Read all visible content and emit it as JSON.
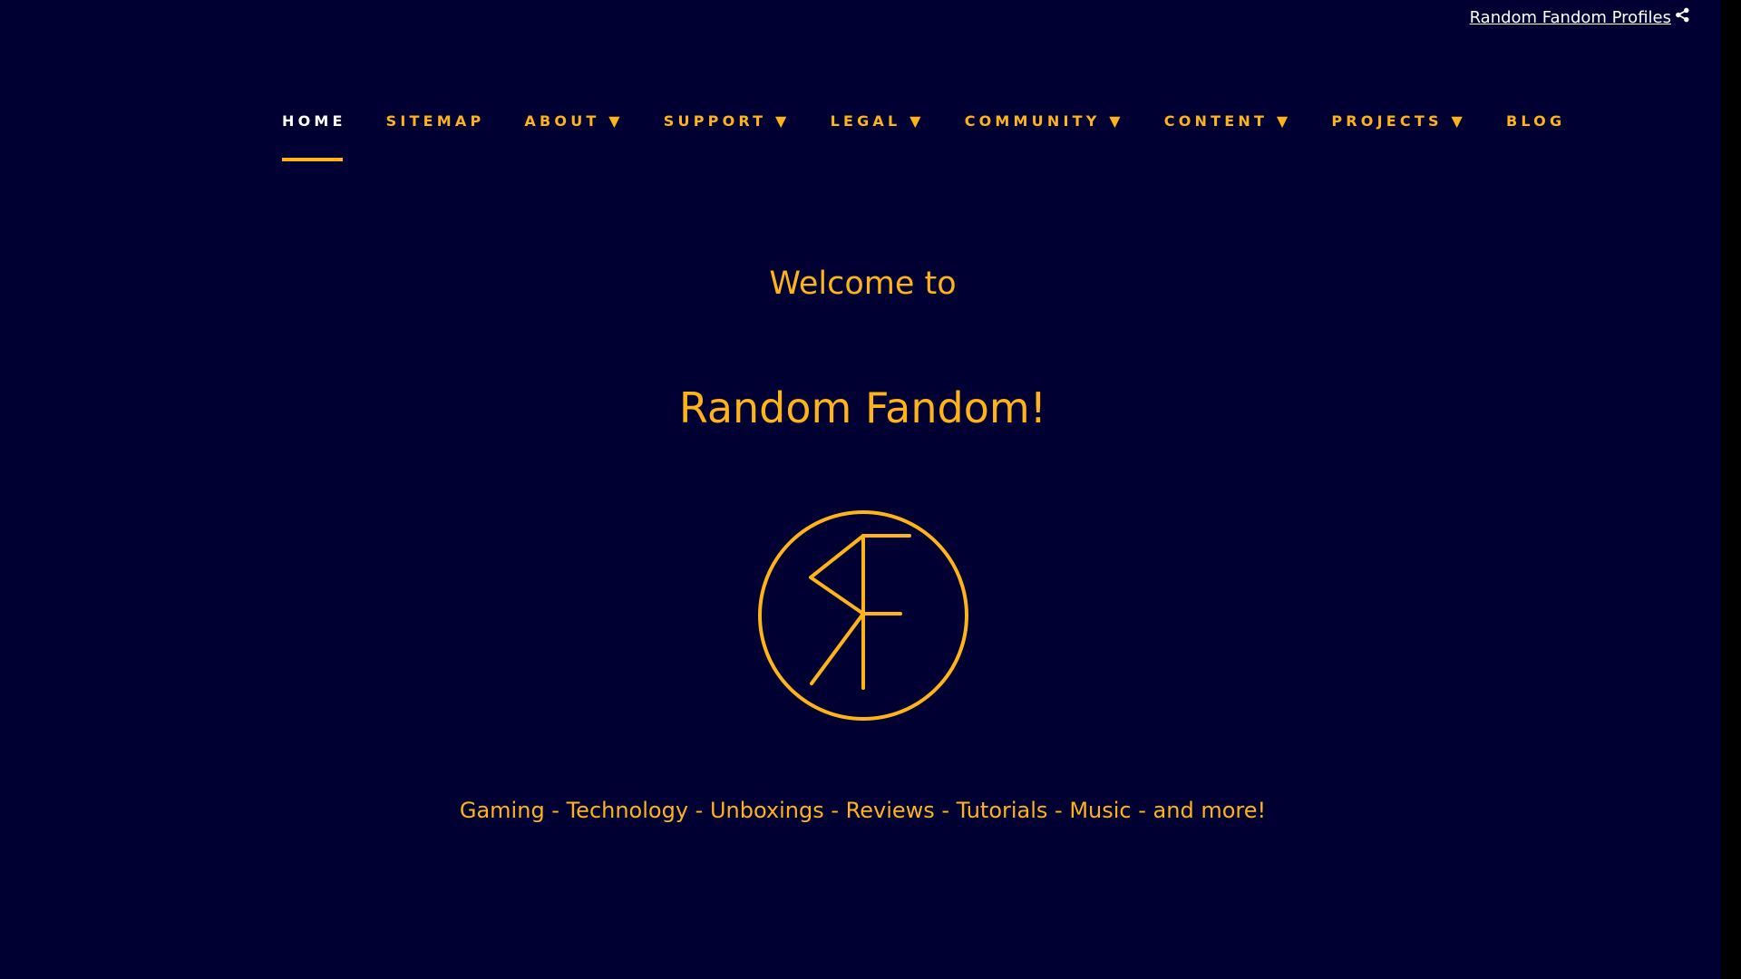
{
  "top_link": {
    "label": "Random Fandom Profiles",
    "icon": "share-icon"
  },
  "nav": {
    "items": [
      {
        "label": "HOME",
        "active": true
      },
      {
        "label": "SITEMAP"
      },
      {
        "label": "ABOUT ▼"
      },
      {
        "label": "SUPPORT ▼"
      },
      {
        "label": "LEGAL ▼"
      },
      {
        "label": "COMMUNITY ▼"
      },
      {
        "label": "CONTENT ▼"
      },
      {
        "label": "PROJECTS ▼"
      },
      {
        "label": "BLOG"
      }
    ]
  },
  "hero": {
    "welcome": "Welcome to",
    "title": "Random Fandom!",
    "logo": "rf-circle-logo",
    "tagline": "Gaming - Technology - Unboxings - Reviews - Tutorials - Music - and more!"
  },
  "colors": {
    "background": "#000033",
    "accent": "#ffb31a",
    "link": "#ffffff"
  }
}
